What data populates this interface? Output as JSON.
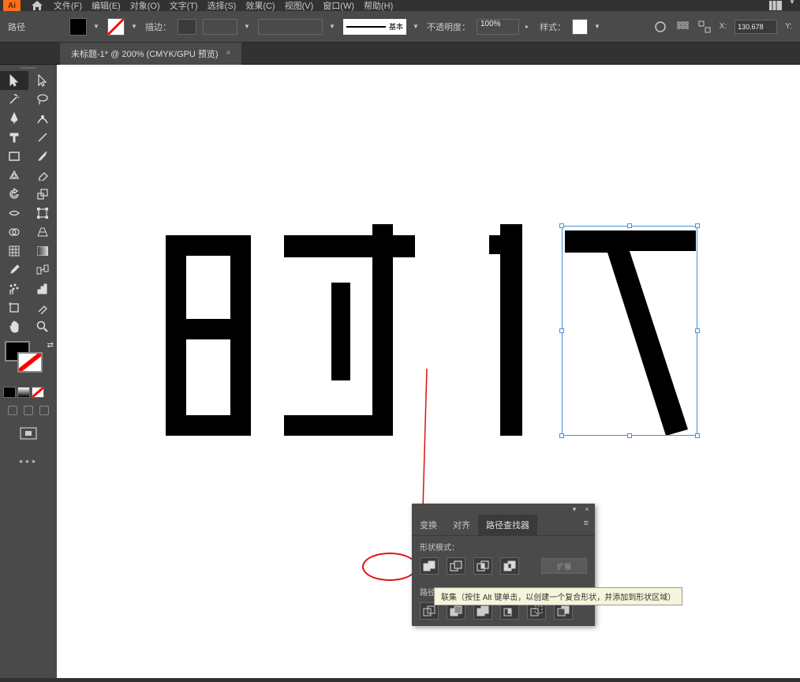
{
  "app": {
    "logo": "Ai"
  },
  "menu": {
    "items": [
      "文件(F)",
      "编辑(E)",
      "对象(O)",
      "文字(T)",
      "选择(S)",
      "效果(C)",
      "视图(V)",
      "窗口(W)",
      "帮助(H)"
    ]
  },
  "control": {
    "object_label": "路径",
    "stroke_label": "描边：",
    "stroke_style_text": "基本",
    "opacity_label": "不透明度：",
    "opacity_value": "100%",
    "style_label": "样式：",
    "x_label": "X:",
    "x_value": "130.678",
    "y_label": "Y:"
  },
  "tab": {
    "title": "未标题-1* @ 200% (CMYK/GPU 预览)",
    "close": "×"
  },
  "panel": {
    "tabs": [
      "变换",
      "对齐",
      "路径查找器"
    ],
    "section1": "形状模式：",
    "section2": "路径查找器：",
    "expand": "扩展",
    "menu_glyph": "≡",
    "minimize": "▾",
    "close": "×"
  },
  "tooltip": {
    "text": "联集（按住 Alt 键单击，以创建一个复合形状，并添加到形状区域）"
  }
}
